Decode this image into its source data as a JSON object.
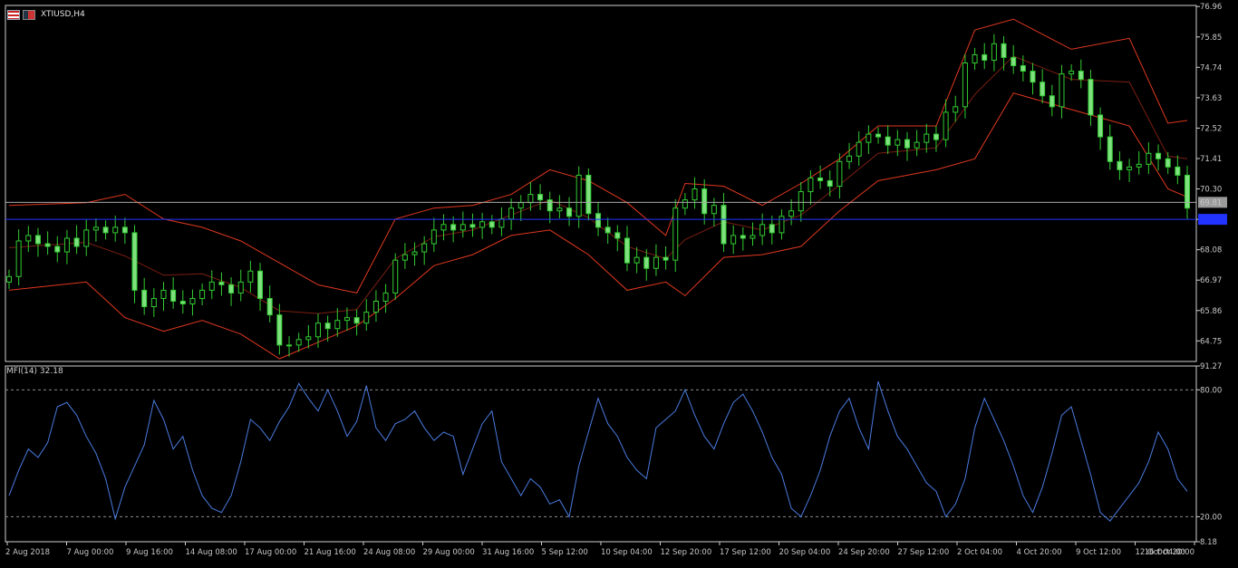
{
  "window": {
    "title": "XTIUSD,H4"
  },
  "indicator": {
    "title": "MFI(14) 32.18"
  },
  "colors": {
    "bull": "#32cd32",
    "bear": "#7fe07f",
    "bands": "#e0381f",
    "mfi": "#4a7be0",
    "bid": "#a8a8a8",
    "ask": "#2233ff",
    "frame": "#d0d0d0",
    "grid": "#8a8a8a"
  },
  "icons": [
    "chart-window-icon",
    "symbol-flag-icon"
  ],
  "chart_data": [
    {
      "type": "candlestick",
      "name": "XTIUSD,H4",
      "ylim": [
        64.0,
        77.0
      ],
      "y_ticks": [
        "76.96",
        "75.85",
        "74.74",
        "73.63",
        "72.52",
        "71.41",
        "70.30",
        "69.19",
        "68.08",
        "66.97",
        "65.86",
        "64.75"
      ],
      "x_ticks": [
        "2 Aug 2018",
        "7 Aug 00:00",
        "9 Aug 16:00",
        "14 Aug 08:00",
        "17 Aug 00:00",
        "21 Aug 16:00",
        "24 Aug 08:00",
        "29 Aug 00:00",
        "31 Aug 16:00",
        "5 Sep 12:00",
        "10 Sep 04:00",
        "12 Sep 20:00",
        "17 Sep 12:00",
        "20 Sep 04:00",
        "24 Sep 20:00",
        "27 Sep 12:00",
        "2 Oct 04:00",
        "4 Oct 20:00",
        "9 Oct 12:00",
        "12 Oct 04:00",
        "16 Oct 20:00"
      ],
      "close_series": [
        [
          0,
          67.1
        ],
        [
          1,
          68.4
        ],
        [
          2,
          68.6
        ],
        [
          3,
          68.3
        ],
        [
          4,
          68.2
        ],
        [
          5,
          68.0
        ],
        [
          6,
          68.5
        ],
        [
          7,
          68.2
        ],
        [
          8,
          68.8
        ],
        [
          9,
          68.9
        ],
        [
          10,
          68.7
        ],
        [
          11,
          68.9
        ],
        [
          12,
          68.7
        ],
        [
          13,
          66.6
        ],
        [
          14,
          66.0
        ],
        [
          15,
          66.3
        ],
        [
          16,
          66.6
        ],
        [
          17,
          66.2
        ],
        [
          18,
          66.1
        ],
        [
          19,
          66.3
        ],
        [
          20,
          66.6
        ],
        [
          21,
          66.9
        ],
        [
          22,
          66.8
        ],
        [
          23,
          66.5
        ],
        [
          24,
          66.9
        ],
        [
          25,
          67.3
        ],
        [
          26,
          66.3
        ],
        [
          27,
          65.7
        ],
        [
          28,
          64.6
        ],
        [
          29,
          64.6
        ],
        [
          30,
          64.8
        ],
        [
          31,
          64.9
        ],
        [
          32,
          65.4
        ],
        [
          33,
          65.2
        ],
        [
          34,
          65.5
        ],
        [
          35,
          65.6
        ],
        [
          36,
          65.4
        ],
        [
          37,
          65.8
        ],
        [
          38,
          66.2
        ],
        [
          39,
          66.5
        ],
        [
          40,
          67.7
        ],
        [
          41,
          67.9
        ],
        [
          42,
          68.0
        ],
        [
          43,
          68.3
        ],
        [
          44,
          68.8
        ],
        [
          45,
          69.0
        ],
        [
          46,
          68.8
        ],
        [
          47,
          69.0
        ],
        [
          48,
          68.9
        ],
        [
          49,
          69.1
        ],
        [
          50,
          68.9
        ],
        [
          51,
          69.2
        ],
        [
          52,
          69.6
        ],
        [
          53,
          69.8
        ],
        [
          54,
          70.1
        ],
        [
          55,
          69.9
        ],
        [
          56,
          69.5
        ],
        [
          57,
          69.6
        ],
        [
          58,
          69.3
        ],
        [
          59,
          70.8
        ],
        [
          60,
          69.4
        ],
        [
          61,
          68.9
        ],
        [
          62,
          68.7
        ],
        [
          63,
          68.5
        ],
        [
          64,
          67.6
        ],
        [
          65,
          67.8
        ],
        [
          66,
          67.4
        ],
        [
          67,
          67.8
        ],
        [
          68,
          67.7
        ],
        [
          69,
          69.6
        ],
        [
          70,
          69.9
        ],
        [
          71,
          70.3
        ],
        [
          72,
          69.4
        ],
        [
          73,
          69.7
        ],
        [
          74,
          68.3
        ],
        [
          75,
          68.6
        ],
        [
          76,
          68.5
        ],
        [
          77,
          68.6
        ],
        [
          78,
          69.0
        ],
        [
          79,
          68.7
        ],
        [
          80,
          69.3
        ],
        [
          81,
          69.5
        ],
        [
          82,
          70.2
        ],
        [
          83,
          70.7
        ],
        [
          84,
          70.6
        ],
        [
          85,
          70.4
        ],
        [
          86,
          71.3
        ],
        [
          87,
          71.5
        ],
        [
          88,
          72.0
        ],
        [
          89,
          72.3
        ],
        [
          90,
          72.2
        ],
        [
          91,
          71.9
        ],
        [
          92,
          72.1
        ],
        [
          93,
          71.8
        ],
        [
          94,
          72.0
        ],
        [
          95,
          72.3
        ],
        [
          96,
          72.1
        ],
        [
          97,
          73.1
        ],
        [
          98,
          73.3
        ],
        [
          99,
          74.9
        ],
        [
          100,
          75.2
        ],
        [
          101,
          75.0
        ],
        [
          102,
          75.6
        ],
        [
          103,
          75.1
        ],
        [
          104,
          74.8
        ],
        [
          105,
          74.6
        ],
        [
          106,
          74.2
        ],
        [
          107,
          73.7
        ],
        [
          108,
          73.3
        ],
        [
          109,
          74.5
        ],
        [
          110,
          74.6
        ],
        [
          111,
          74.3
        ],
        [
          112,
          73.0
        ],
        [
          113,
          72.2
        ],
        [
          114,
          71.3
        ],
        [
          115,
          71.0
        ],
        [
          116,
          71.1
        ],
        [
          117,
          71.2
        ],
        [
          118,
          71.6
        ],
        [
          119,
          71.4
        ],
        [
          120,
          71.1
        ],
        [
          121,
          70.8
        ],
        [
          122,
          69.6
        ]
      ],
      "bands_upper": [
        [
          0,
          69.7
        ],
        [
          8,
          69.8
        ],
        [
          12,
          70.1
        ],
        [
          16,
          69.2
        ],
        [
          20,
          68.9
        ],
        [
          24,
          68.4
        ],
        [
          28,
          67.6
        ],
        [
          32,
          66.8
        ],
        [
          36,
          66.5
        ],
        [
          40,
          69.2
        ],
        [
          44,
          69.6
        ],
        [
          48,
          69.7
        ],
        [
          52,
          70.1
        ],
        [
          56,
          71.0
        ],
        [
          60,
          70.6
        ],
        [
          64,
          69.8
        ],
        [
          68,
          68.6
        ],
        [
          70,
          70.5
        ],
        [
          74,
          70.4
        ],
        [
          78,
          69.7
        ],
        [
          82,
          70.5
        ],
        [
          86,
          71.4
        ],
        [
          90,
          72.6
        ],
        [
          96,
          72.6
        ],
        [
          100,
          76.1
        ],
        [
          104,
          76.5
        ],
        [
          110,
          75.4
        ],
        [
          116,
          75.8
        ],
        [
          120,
          72.7
        ],
        [
          122,
          72.8
        ]
      ],
      "bands_lower": [
        [
          0,
          66.6
        ],
        [
          8,
          66.9
        ],
        [
          12,
          65.6
        ],
        [
          16,
          65.1
        ],
        [
          20,
          65.5
        ],
        [
          24,
          65.0
        ],
        [
          28,
          64.1
        ],
        [
          32,
          64.7
        ],
        [
          36,
          65.3
        ],
        [
          40,
          66.3
        ],
        [
          44,
          67.5
        ],
        [
          48,
          67.9
        ],
        [
          52,
          68.6
        ],
        [
          56,
          68.8
        ],
        [
          60,
          67.9
        ],
        [
          64,
          66.6
        ],
        [
          68,
          66.9
        ],
        [
          70,
          66.4
        ],
        [
          74,
          67.8
        ],
        [
          78,
          67.9
        ],
        [
          82,
          68.2
        ],
        [
          86,
          69.5
        ],
        [
          90,
          70.6
        ],
        [
          96,
          71.0
        ],
        [
          100,
          71.4
        ],
        [
          104,
          73.8
        ],
        [
          110,
          73.2
        ],
        [
          116,
          72.6
        ],
        [
          120,
          70.3
        ],
        [
          122,
          70.0
        ]
      ],
      "current_price": "69.81",
      "bid_line": 69.81,
      "ask_line": 69.19
    },
    {
      "type": "line",
      "name": "MFI(14) 32.18",
      "ylim": [
        8.18,
        91.27
      ],
      "y_ticks": [
        "91.27",
        "80.00",
        "20.00",
        "8.18"
      ],
      "levels": [
        80.0,
        20.0
      ],
      "values": [
        [
          0,
          30
        ],
        [
          1,
          42
        ],
        [
          2,
          52
        ],
        [
          3,
          48
        ],
        [
          4,
          55
        ],
        [
          5,
          72
        ],
        [
          6,
          74
        ],
        [
          7,
          68
        ],
        [
          8,
          58
        ],
        [
          9,
          50
        ],
        [
          10,
          38
        ],
        [
          11,
          19
        ],
        [
          12,
          34
        ],
        [
          13,
          44
        ],
        [
          14,
          54
        ],
        [
          15,
          75
        ],
        [
          16,
          66
        ],
        [
          17,
          52
        ],
        [
          18,
          58
        ],
        [
          19,
          42
        ],
        [
          20,
          30
        ],
        [
          21,
          24
        ],
        [
          22,
          22
        ],
        [
          23,
          30
        ],
        [
          24,
          46
        ],
        [
          25,
          66
        ],
        [
          26,
          62
        ],
        [
          27,
          56
        ],
        [
          28,
          65
        ],
        [
          29,
          72
        ],
        [
          30,
          83
        ],
        [
          31,
          76
        ],
        [
          32,
          70
        ],
        [
          33,
          80
        ],
        [
          34,
          70
        ],
        [
          35,
          58
        ],
        [
          36,
          65
        ],
        [
          37,
          82
        ],
        [
          38,
          62
        ],
        [
          39,
          56
        ],
        [
          40,
          64
        ],
        [
          41,
          66
        ],
        [
          42,
          70
        ],
        [
          43,
          62
        ],
        [
          44,
          56
        ],
        [
          45,
          60
        ],
        [
          46,
          58
        ],
        [
          47,
          40
        ],
        [
          48,
          52
        ],
        [
          49,
          64
        ],
        [
          50,
          70
        ],
        [
          51,
          46
        ],
        [
          52,
          38
        ],
        [
          53,
          30
        ],
        [
          54,
          38
        ],
        [
          55,
          34
        ],
        [
          56,
          26
        ],
        [
          57,
          28
        ],
        [
          58,
          20
        ],
        [
          59,
          44
        ],
        [
          60,
          60
        ],
        [
          61,
          76
        ],
        [
          62,
          64
        ],
        [
          63,
          58
        ],
        [
          64,
          48
        ],
        [
          65,
          42
        ],
        [
          66,
          38
        ],
        [
          67,
          62
        ],
        [
          68,
          66
        ],
        [
          69,
          70
        ],
        [
          70,
          80
        ],
        [
          71,
          68
        ],
        [
          72,
          58
        ],
        [
          73,
          52
        ],
        [
          74,
          64
        ],
        [
          75,
          74
        ],
        [
          76,
          78
        ],
        [
          77,
          70
        ],
        [
          78,
          60
        ],
        [
          79,
          48
        ],
        [
          80,
          40
        ],
        [
          81,
          24
        ],
        [
          82,
          20
        ],
        [
          83,
          30
        ],
        [
          84,
          42
        ],
        [
          85,
          58
        ],
        [
          86,
          70
        ],
        [
          87,
          76
        ],
        [
          88,
          62
        ],
        [
          89,
          52
        ],
        [
          90,
          84
        ],
        [
          91,
          70
        ],
        [
          92,
          58
        ],
        [
          93,
          52
        ],
        [
          94,
          44
        ],
        [
          95,
          36
        ],
        [
          96,
          32
        ],
        [
          97,
          20
        ],
        [
          98,
          26
        ],
        [
          99,
          38
        ],
        [
          100,
          62
        ],
        [
          101,
          76
        ],
        [
          102,
          66
        ],
        [
          103,
          56
        ],
        [
          104,
          44
        ],
        [
          105,
          30
        ],
        [
          106,
          22
        ],
        [
          107,
          34
        ],
        [
          108,
          50
        ],
        [
          109,
          68
        ],
        [
          110,
          72
        ],
        [
          111,
          56
        ],
        [
          112,
          40
        ],
        [
          113,
          22
        ],
        [
          114,
          18
        ],
        [
          115,
          24
        ],
        [
          116,
          30
        ],
        [
          117,
          36
        ],
        [
          118,
          46
        ],
        [
          119,
          60
        ],
        [
          120,
          52
        ],
        [
          121,
          38
        ],
        [
          122,
          32
        ]
      ]
    }
  ]
}
